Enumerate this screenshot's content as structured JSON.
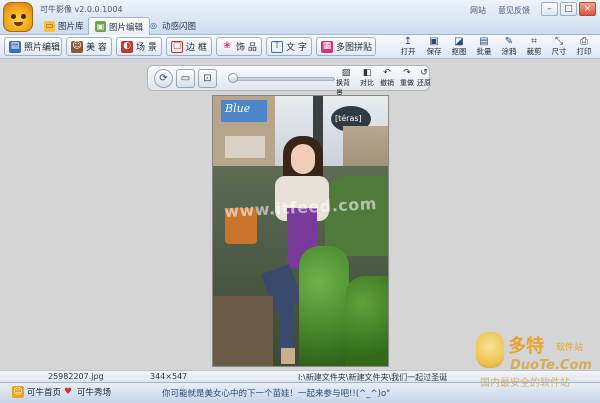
{
  "app": {
    "title": "可牛影像 v2.0.0.1004",
    "tabs": [
      {
        "label": "图片库",
        "icon": "folder-icon"
      },
      {
        "label": "图片编辑",
        "icon": "image-edit-icon"
      },
      {
        "label": "动感闪图",
        "icon": "animation-icon"
      }
    ],
    "links": [
      "网站",
      "意见反馈"
    ],
    "window_controls": {
      "minimize": "–",
      "maximize": "□",
      "close": "×"
    }
  },
  "toolbar": {
    "buttons": [
      {
        "label": "照片编辑",
        "icon": "photo-edit-icon"
      },
      {
        "label": "美 容",
        "icon": "face-beauty-icon"
      },
      {
        "label": "场 景",
        "icon": "scene-icon"
      },
      {
        "label": "边 框",
        "icon": "frame-icon"
      },
      {
        "label": "饰 品",
        "icon": "decoration-icon"
      },
      {
        "label": "文 字",
        "icon": "text-icon"
      },
      {
        "label": "多图拼贴",
        "icon": "collage-icon"
      }
    ],
    "right_tools": [
      {
        "label": "打开",
        "icon": "open-icon"
      },
      {
        "label": "保存",
        "icon": "save-icon"
      },
      {
        "label": "抠图",
        "icon": "cutout-icon"
      },
      {
        "label": "批量",
        "icon": "batch-icon"
      },
      {
        "label": "涂鸦",
        "icon": "doodle-icon"
      },
      {
        "label": "裁剪",
        "icon": "crop-icon"
      },
      {
        "label": "尺寸",
        "icon": "resize-icon"
      },
      {
        "label": "打印",
        "icon": "print-icon"
      }
    ]
  },
  "editbar": {
    "view_buttons": [
      {
        "icon": "rotate-icon"
      },
      {
        "icon": "fit-screen-icon"
      },
      {
        "icon": "actual-size-icon"
      }
    ],
    "zoom_fraction": 0.0,
    "tools": [
      {
        "label": "换背景",
        "icon": "swap-background-icon"
      },
      {
        "label": "对比",
        "icon": "compare-icon"
      },
      {
        "label": "撤销",
        "icon": "undo-icon"
      },
      {
        "label": "重做",
        "icon": "redo-icon"
      },
      {
        "label": "还原",
        "icon": "restore-icon"
      }
    ]
  },
  "photo": {
    "watermark_text": "www.itfeed.com",
    "sign_text": "Blue",
    "shop_sign": "[téras]"
  },
  "status": {
    "filename": "25982207.jpg",
    "dimensions": "344×547",
    "path": "I:\\新建文件夹\\新建文件夹\\我们一起过圣诞"
  },
  "bottom": {
    "home_label": "可牛首页",
    "forum_label": "可牛秀场",
    "marquee": "你可能就是美女心中的下一个苗娃！一起来参与吧!!(^_^)o\""
  },
  "brand": {
    "name": "多特",
    "sub": "软件站",
    "domain": "DuoTe.Com",
    "tagline": "国内最安全的软件站"
  },
  "colors": {
    "titlebar": "#cddcee",
    "canvas_bg": "#d5d5d5",
    "accent": "#2d4a70"
  }
}
